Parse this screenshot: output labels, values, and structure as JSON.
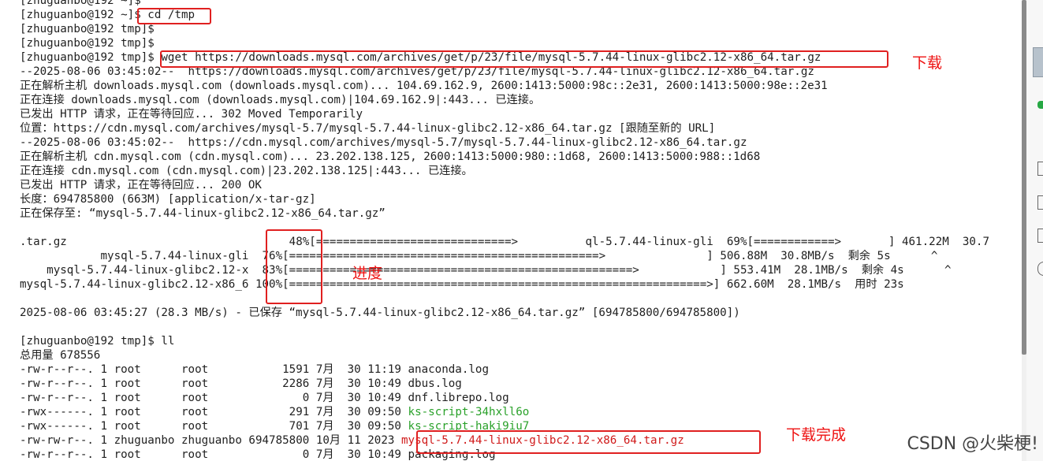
{
  "terminal": {
    "lines": [
      {
        "text": "[zhuguanbo@192 ~]$"
      },
      {
        "text": "[zhuguanbo@192 ~]$ cd /tmp"
      },
      {
        "text": "[zhuguanbo@192 tmp]$"
      },
      {
        "text": "[zhuguanbo@192 tmp]$"
      },
      {
        "text": "[zhuguanbo@192 tmp]$ wget https://downloads.mysql.com/archives/get/p/23/file/mysql-5.7.44-linux-glibc2.12-x86_64.tar.gz"
      },
      {
        "text": "--2025-08-06 03:45:02--  https://downloads.mysql.com/archives/get/p/23/file/mysql-5.7.44-linux-glibc2.12-x86_64.tar.gz"
      },
      {
        "text": "正在解析主机 downloads.mysql.com (downloads.mysql.com)... 104.69.162.9, 2600:1413:5000:98c::2e31, 2600:1413:5000:98e::2e31"
      },
      {
        "text": "正在连接 downloads.mysql.com (downloads.mysql.com)|104.69.162.9|:443... 已连接。"
      },
      {
        "text": "已发出 HTTP 请求，正在等待回应... 302 Moved Temporarily"
      },
      {
        "text": "位置：https://cdn.mysql.com/archives/mysql-5.7/mysql-5.7.44-linux-glibc2.12-x86_64.tar.gz [跟随至新的 URL]"
      },
      {
        "text": "--2025-08-06 03:45:02--  https://cdn.mysql.com/archives/mysql-5.7/mysql-5.7.44-linux-glibc2.12-x86_64.tar.gz"
      },
      {
        "text": "正在解析主机 cdn.mysql.com (cdn.mysql.com)... 23.202.138.125, 2600:1413:5000:980::1d68, 2600:1413:5000:988::1d68"
      },
      {
        "text": "正在连接 cdn.mysql.com (cdn.mysql.com)|23.202.138.125|:443... 已连接。"
      },
      {
        "text": "已发出 HTTP 请求，正在等待回应... 200 OK"
      },
      {
        "text": "长度：694785800 (663M) [application/x-tar-gz]"
      },
      {
        "text": "正在保存至: “mysql-5.7.44-linux-glibc2.12-x86_64.tar.gz”"
      },
      {
        "text": ""
      },
      {
        "text": ".tar.gz                                 48%[=============================>          ql-5.7.44-linux-gli  69%[============>       ] 461.22M  30.7"
      },
      {
        "text": "            mysql-5.7.44-linux-gli  76%[==============================================>               ] 506.88M  30.8MB/s  剩余 5s      ^"
      },
      {
        "text": "    mysql-5.7.44-linux-glibc2.12-x  83%[===================================================>            ] 553.41M  28.1MB/s  剩余 4s      ^"
      },
      {
        "text": "mysql-5.7.44-linux-glibc2.12-x86_6 100%[==============================================================>] 662.60M  28.1MB/s  用时 23s"
      },
      {
        "text": ""
      },
      {
        "text": "2025-08-06 03:45:27 (28.3 MB/s) - 已保存 “mysql-5.7.44-linux-glibc2.12-x86_64.tar.gz” [694785800/694785800])"
      },
      {
        "text": ""
      },
      {
        "text": "[zhuguanbo@192 tmp]$ ll"
      },
      {
        "text": "总用量 678556"
      },
      {
        "text": "-rw-r--r--. 1 root      root           1591 7月  30 11:19 anaconda.log"
      },
      {
        "text": "-rw-r--r--. 1 root      root           2286 7月  30 10:49 dbus.log"
      },
      {
        "text": "-rw-r--r--. 1 root      root              0 7月  30 10:49 dnf.librepo.log"
      },
      {
        "text": "-rwx------. 1 root      root            291 7月  30 09:50 ",
        "hl": "ks-script-34hxll6o",
        "hl_color": "green"
      },
      {
        "text": "-rwx------. 1 root      root            701 7月  30 09:50 ",
        "hl": "ks-script-haki9iu7",
        "hl_color": "green"
      },
      {
        "text": "-rw-rw-r--. 1 zhuguanbo zhuguanbo 694785800 10月 11 2023 ",
        "hl": "mysql-5.7.44-linux-glibc2.12-x86_64.tar.gz",
        "hl_color": "red"
      },
      {
        "text": "-rw-r--r--. 1 root      root              0 7月  30 10:49 packaging.log"
      }
    ]
  },
  "annotations": {
    "download": "下载",
    "progress": "进度",
    "download_done": "下载完成"
  },
  "watermark": "CSDN @火柴梗!",
  "colors": {
    "annotation": "#e02020",
    "exec_file": "#2aa12a",
    "archive_file": "#d01919"
  }
}
